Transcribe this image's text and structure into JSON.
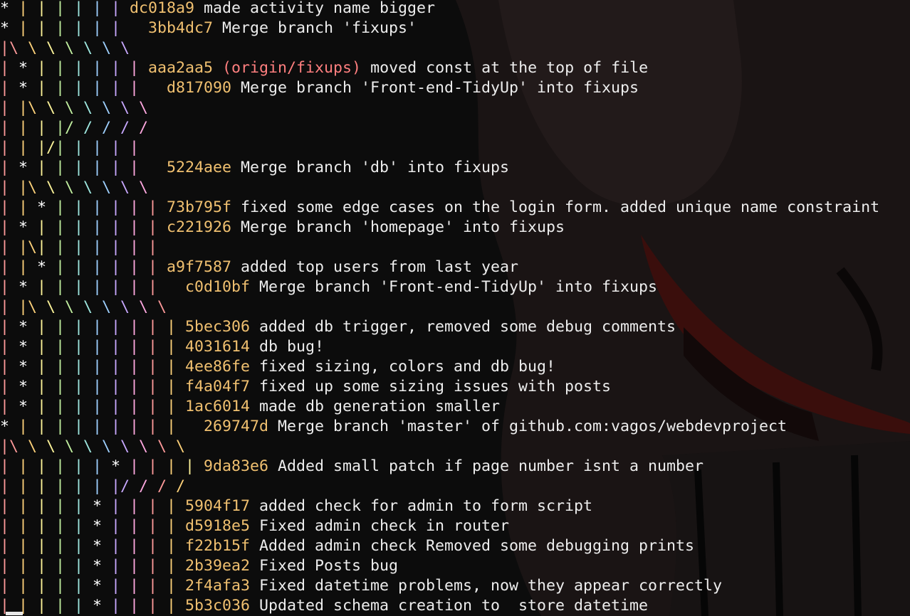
{
  "theme": {
    "background": "#0c0c0c",
    "text": "#ededed",
    "hash_color": "#f0c070",
    "ref_color": "#ff7f7f",
    "graph_palette": [
      "#ffffff",
      "#ff9a9a",
      "#ffd27a",
      "#fff59a",
      "#c2f0a0",
      "#9fe8e0",
      "#9ed0ff",
      "#c8a8ff",
      "#ffa8e0"
    ],
    "wallpaper": "dark-gengar-ghost"
  },
  "log": [
    {
      "graph": "* | | | | | | ",
      "hash": "dc018a9",
      "refs": "",
      "message": "made activity name bigger"
    },
    {
      "graph": "* | | | | | |   ",
      "hash": "3bb4dc7",
      "refs": "",
      "message": "Merge branch 'fixups'"
    },
    {
      "graph": "|\\ \\ \\ \\ \\ \\ \\",
      "hash": "",
      "refs": "",
      "message": ""
    },
    {
      "graph": "| * | | | | | | ",
      "hash": "aaa2aa5",
      "refs": "(origin/fixups)",
      "message": "moved const at the top of file"
    },
    {
      "graph": "| * | | | | | |   ",
      "hash": "d817090",
      "refs": "",
      "message": "Merge branch 'Front-end-TidyUp' into fixups"
    },
    {
      "graph": "| |\\ \\ \\ \\ \\ \\ \\",
      "hash": "",
      "refs": "",
      "message": ""
    },
    {
      "graph": "| | | |/ / / / /",
      "hash": "",
      "refs": "",
      "message": ""
    },
    {
      "graph": "| | |/| | | | |",
      "hash": "",
      "refs": "",
      "message": ""
    },
    {
      "graph": "| * | | | | | |   ",
      "hash": "5224aee",
      "refs": "",
      "message": "Merge branch 'db' into fixups"
    },
    {
      "graph": "| |\\ \\ \\ \\ \\ \\ \\",
      "hash": "",
      "refs": "",
      "message": ""
    },
    {
      "graph": "| | * | | | | | | ",
      "hash": "73b795f",
      "refs": "",
      "message": "fixed some edge cases on the login form. added unique name constraint"
    },
    {
      "graph": "| * | | | | | | | ",
      "hash": "c221926",
      "refs": "",
      "message": "Merge branch 'homepage' into fixups"
    },
    {
      "graph": "| |\\| | | | | | |",
      "hash": "",
      "refs": "",
      "message": ""
    },
    {
      "graph": "| | * | | | | | | ",
      "hash": "a9f7587",
      "refs": "",
      "message": "added top users from last year"
    },
    {
      "graph": "| * | | | | | | |   ",
      "hash": "c0d10bf",
      "refs": "",
      "message": "Merge branch 'Front-end-TidyUp' into fixups"
    },
    {
      "graph": "| |\\ \\ \\ \\ \\ \\ \\ \\",
      "hash": "",
      "refs": "",
      "message": ""
    },
    {
      "graph": "| * | | | | | | | | ",
      "hash": "5bec306",
      "refs": "",
      "message": "added db trigger, removed some debug comments"
    },
    {
      "graph": "| * | | | | | | | | ",
      "hash": "4031614",
      "refs": "",
      "message": "db bug!"
    },
    {
      "graph": "| * | | | | | | | | ",
      "hash": "4ee86fe",
      "refs": "",
      "message": "fixed sizing, colors and db bug!"
    },
    {
      "graph": "| * | | | | | | | | ",
      "hash": "f4a04f7",
      "refs": "",
      "message": "fixed up some sizing issues with posts"
    },
    {
      "graph": "| * | | | | | | | | ",
      "hash": "1ac6014",
      "refs": "",
      "message": "made db generation smaller"
    },
    {
      "graph": "* | | | | | | | | |   ",
      "hash": "269747d",
      "refs": "",
      "message": "Merge branch 'master' of github.com:vagos/webdevproject"
    },
    {
      "graph": "|\\ \\ \\ \\ \\ \\ \\ \\ \\ \\",
      "hash": "",
      "refs": "",
      "message": ""
    },
    {
      "graph": "| | | | | | * | | | | ",
      "hash": "9da83e6",
      "refs": "",
      "message": "Added small patch if page number isnt a number"
    },
    {
      "graph": "| | | | | | |/ / / /",
      "hash": "",
      "refs": "",
      "message": ""
    },
    {
      "graph": "| | | | | * | | | | ",
      "hash": "5904f17",
      "refs": "",
      "message": "added check for admin to form script"
    },
    {
      "graph": "| | | | | * | | | | ",
      "hash": "d5918e5",
      "refs": "",
      "message": "Fixed admin check in router"
    },
    {
      "graph": "| | | | | * | | | | ",
      "hash": "f22b15f",
      "refs": "",
      "message": "Added admin check Removed some debugging prints"
    },
    {
      "graph": "| | | | | * | | | | ",
      "hash": "2b39ea2",
      "refs": "",
      "message": "Fixed Posts bug"
    },
    {
      "graph": "| | | | | * | | | | ",
      "hash": "2f4afa3",
      "refs": "",
      "message": "Fixed datetime problems, now they appear correctly"
    },
    {
      "graph": "| | | | | * | | | | ",
      "hash": "5b3c036",
      "refs": "",
      "message": "Updated schema creation to  store datetime"
    }
  ]
}
